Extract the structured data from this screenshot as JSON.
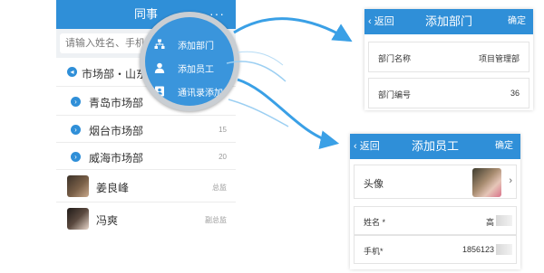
{
  "contacts": {
    "header_title": "同事",
    "more_icon": "···",
    "search_placeholder": "请输入姓名、手机",
    "org_path": "市场部・山东",
    "departments": [
      {
        "name": "青岛市场部",
        "count": ""
      },
      {
        "name": "烟台市场部",
        "count": "15"
      },
      {
        "name": "威海市场部",
        "count": "20"
      }
    ],
    "people": [
      {
        "name": "姜良峰",
        "title": "总监"
      },
      {
        "name": "冯爽",
        "title": "副总监"
      }
    ]
  },
  "popup_menu": {
    "items": [
      {
        "label": "添加部门",
        "icon": "department-icon"
      },
      {
        "label": "添加员工",
        "icon": "person-icon"
      },
      {
        "label": "通讯录添加",
        "icon": "contacts-icon"
      }
    ]
  },
  "add_department": {
    "back_label": "返回",
    "title": "添加部门",
    "confirm_label": "确定",
    "fields": [
      {
        "label": "部门名称",
        "value": "项目管理部"
      },
      {
        "label": "部门编号",
        "value": "36"
      }
    ]
  },
  "add_employee": {
    "back_label": "返回",
    "title": "添加员工",
    "confirm_label": "确定",
    "avatar_label": "头像",
    "fields": [
      {
        "label": "姓名 *",
        "value": "高"
      },
      {
        "label": "手机*",
        "value": "1856123"
      }
    ]
  },
  "colors": {
    "accent": "#2f8fd8",
    "arrow": "#3aa0e6",
    "popup": "#3a95dc"
  }
}
